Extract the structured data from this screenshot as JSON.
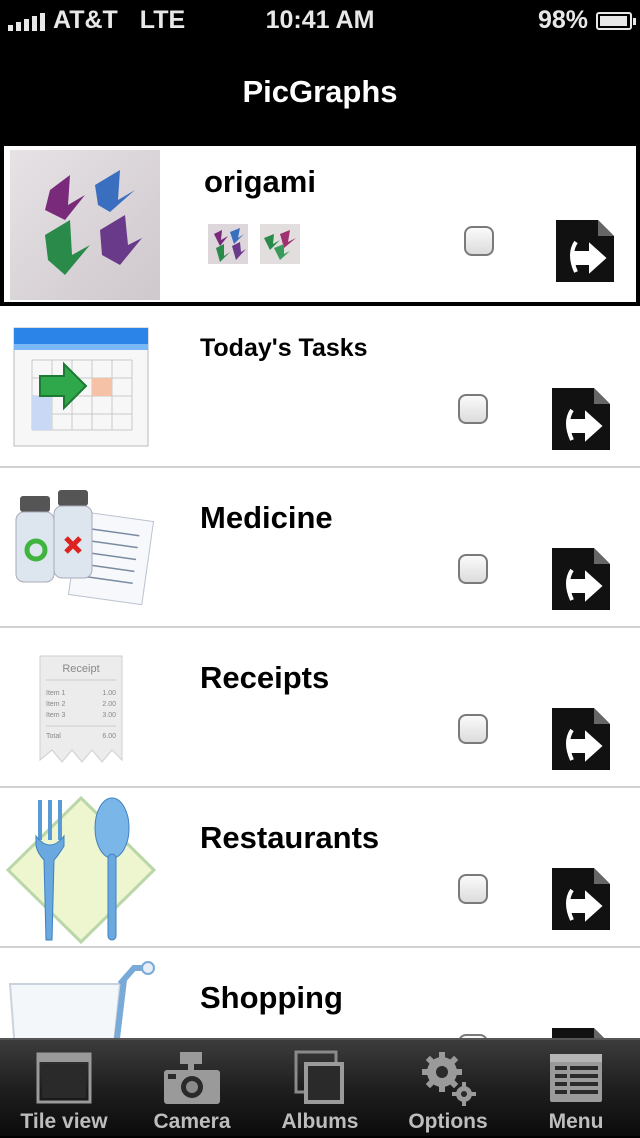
{
  "status_bar": {
    "carrier": "AT&T",
    "network": "LTE",
    "time": "10:41 AM",
    "battery": "98%",
    "battery_level": 0.98
  },
  "nav": {
    "title": "PicGraphs"
  },
  "list": {
    "items": [
      {
        "title": "origami",
        "icon": "origami-photo",
        "checked": false,
        "selected": true
      },
      {
        "title": "Today's Tasks",
        "icon": "calendar-icon",
        "checked": false
      },
      {
        "title": "Medicine",
        "icon": "medicine-icon",
        "checked": false
      },
      {
        "title": "Receipts",
        "icon": "receipt-icon",
        "checked": false,
        "receipt": {
          "header": "Receipt",
          "lines": [
            [
              "Item 1",
              "1.00"
            ],
            [
              "Item 2",
              "2.00"
            ],
            [
              "Item 3",
              "3.00"
            ]
          ],
          "total_label": "Total",
          "total_value": "6.00"
        }
      },
      {
        "title": "Restaurants",
        "icon": "fork-spoon-icon",
        "checked": false
      },
      {
        "title": "Shopping",
        "icon": "shopping-cart-icon",
        "checked": false
      }
    ]
  },
  "tabbar": {
    "tabs": [
      {
        "label": "Tile view",
        "icon": "tile-view-icon"
      },
      {
        "label": "Camera",
        "icon": "camera-icon"
      },
      {
        "label": "Albums",
        "icon": "albums-icon"
      },
      {
        "label": "Options",
        "icon": "gears-icon"
      },
      {
        "label": "Menu",
        "icon": "menu-icon"
      }
    ]
  },
  "colors": {
    "background": "#000000",
    "list_background": "#ffffff",
    "tab_label": "#bdbdbd"
  }
}
